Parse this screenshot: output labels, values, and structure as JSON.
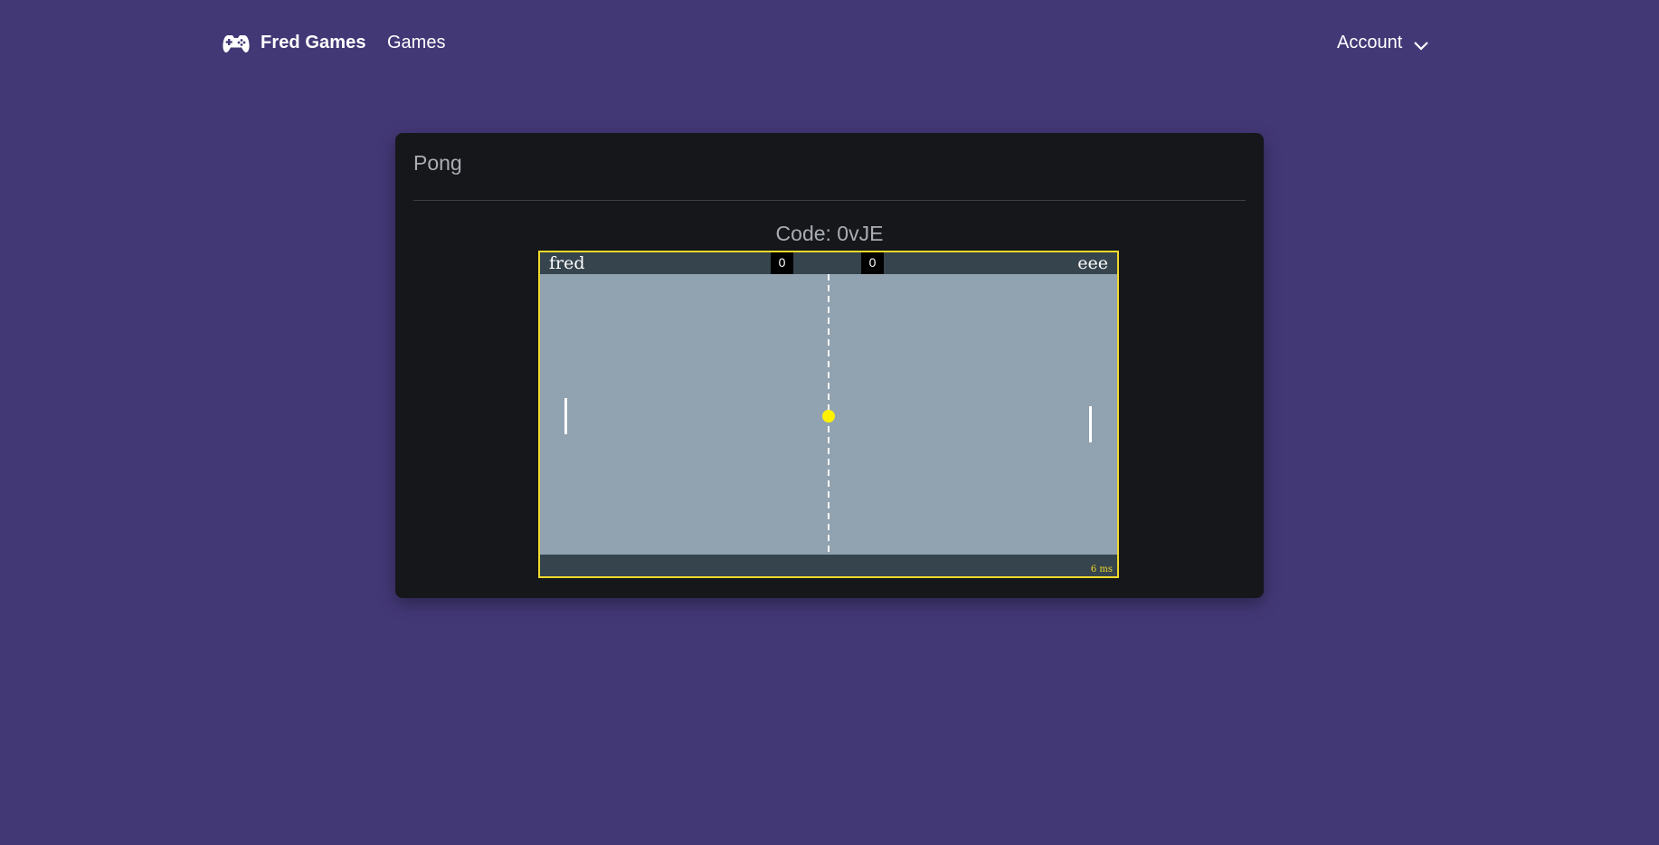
{
  "nav": {
    "brand": "Fred Games",
    "brand_icon": "gamepad-icon",
    "games_link": "Games",
    "account": "Account",
    "account_icon": "chevron-down-icon"
  },
  "card": {
    "title": "Pong",
    "code_text": "Code: 0vJE"
  },
  "game": {
    "player_left": "fred",
    "player_right": "eee",
    "score_left": "0",
    "score_right": "0",
    "latency": "6 ms",
    "colors": {
      "border": "#f0da2a",
      "field": "#91a2b0",
      "bars": "#36444d",
      "ball": "#fff200",
      "paddle": "#ffffff"
    }
  }
}
